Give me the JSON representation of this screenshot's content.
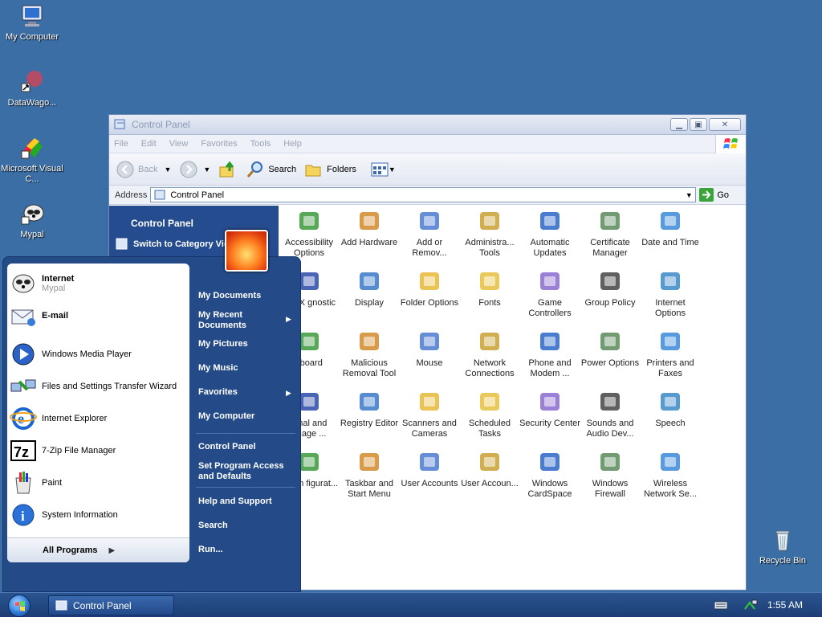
{
  "desktop": {
    "icons": [
      {
        "label": "My Computer",
        "icon": "computer-icon"
      },
      {
        "label": "DataWago...",
        "icon": "shortcut-icon"
      },
      {
        "label": "Microsoft Visual C...",
        "icon": "visual-studio-icon"
      },
      {
        "label": "Mypal",
        "icon": "mypal-icon"
      },
      {
        "label": "Recycle Bin",
        "icon": "recycle-bin-icon"
      }
    ]
  },
  "window": {
    "title": "Control Panel",
    "menu": [
      "File",
      "Edit",
      "View",
      "Favorites",
      "Tools",
      "Help"
    ],
    "toolbar": {
      "back": "Back",
      "search": "Search",
      "folders": "Folders"
    },
    "address": {
      "label": "Address",
      "value": "Control Panel",
      "go": "Go"
    },
    "tasks": {
      "heading": "Control Panel",
      "switch": "Switch to Category Vie"
    },
    "items": [
      {
        "label": "Accessibility Options"
      },
      {
        "label": "Add Hardware"
      },
      {
        "label": "Add or Remov..."
      },
      {
        "label": "Administra... Tools"
      },
      {
        "label": "Automatic Updates"
      },
      {
        "label": "Certificate Manager"
      },
      {
        "label": "Date and Time"
      },
      {
        "label": "irectX gnostic"
      },
      {
        "label": "Display"
      },
      {
        "label": "Folder Options"
      },
      {
        "label": "Fonts"
      },
      {
        "label": "Game Controllers"
      },
      {
        "label": "Group Policy"
      },
      {
        "label": "Internet Options"
      },
      {
        "label": "yboard"
      },
      {
        "label": "Malicious Removal Tool"
      },
      {
        "label": "Mouse"
      },
      {
        "label": "Network Connections"
      },
      {
        "label": "Phone and Modem ..."
      },
      {
        "label": "Power Options"
      },
      {
        "label": "Printers and Faxes"
      },
      {
        "label": "ional and guage ..."
      },
      {
        "label": "Registry Editor"
      },
      {
        "label": "Scanners and Cameras"
      },
      {
        "label": "Scheduled Tasks"
      },
      {
        "label": "Security Center"
      },
      {
        "label": "Sounds and Audio Dev..."
      },
      {
        "label": "Speech"
      },
      {
        "label": "ystem figurat..."
      },
      {
        "label": "Taskbar and Start Menu"
      },
      {
        "label": "User Accounts"
      },
      {
        "label": "User Accoun..."
      },
      {
        "label": "Windows CardSpace"
      },
      {
        "label": "Windows Firewall"
      },
      {
        "label": "Wireless Network Se..."
      }
    ]
  },
  "start_menu": {
    "pinned": [
      {
        "title": "Internet",
        "sub": "Mypal"
      },
      {
        "title": "E-mail",
        "sub": ""
      }
    ],
    "recent": [
      "Windows Media Player",
      "Files and Settings Transfer Wizard",
      "Internet Explorer",
      "7-Zip File Manager",
      "Paint",
      "System Information"
    ],
    "all_programs": "All Programs",
    "right": {
      "my_documents": "My Documents",
      "my_recent_documents": "My Recent Documents",
      "my_pictures": "My Pictures",
      "my_music": "My Music",
      "favorites": "Favorites",
      "my_computer": "My Computer",
      "control_panel": "Control Panel",
      "set_program_access": "Set Program Access and Defaults",
      "help_and_support": "Help and Support",
      "search": "Search",
      "run": "Run..."
    }
  },
  "taskbar": {
    "button": "Control Panel",
    "clock": "1:55 AM"
  }
}
